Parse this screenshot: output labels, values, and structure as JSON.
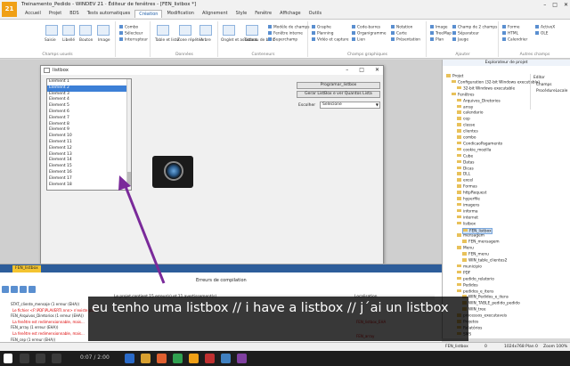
{
  "window": {
    "title": "Treinamento_Pedido - WINDEV 21 · Éditeur de fenêtres - [FEN_listbox *]",
    "logo": "21"
  },
  "ribbon_tabs": [
    {
      "label": "Accueil",
      "active": false
    },
    {
      "label": "Projet",
      "active": false
    },
    {
      "label": "BDS",
      "active": false
    },
    {
      "label": "Tests automatiques",
      "active": false
    },
    {
      "label": "Création",
      "active": true
    },
    {
      "label": "Modification",
      "active": false
    },
    {
      "label": "Alignement",
      "active": false
    },
    {
      "label": "Style",
      "active": false
    },
    {
      "label": "Fenêtre",
      "active": false
    },
    {
      "label": "Affichage",
      "active": false
    },
    {
      "label": "Outils",
      "active": false
    }
  ],
  "ribbon": {
    "groups": [
      "Champs usuels",
      "Données",
      "Conteneurs",
      "Champs graphiques",
      "Ajouter",
      "Autres champs"
    ],
    "buttons": [
      "Saisie",
      "Libellé",
      "Bouton",
      "Image",
      "Table et liste",
      "Zone répétée",
      "Arbre",
      "Onglet et assistant",
      "Tableau de bord"
    ],
    "small_items": [
      "Combo",
      "Sélecteur",
      "Interrupteur",
      "Modèle de champs",
      "Fenêtre interne",
      "Superchamp",
      "Graphe",
      "Planning",
      "Vidéo et capture",
      "Code-barres",
      "Organigramme",
      "Lien",
      "Notation",
      "Carte",
      "Présentation",
      "Image",
      "TreeMap",
      "Plan",
      "Champ de 2 champs",
      "Séparateur",
      "Jauge",
      "Forme",
      "HTML",
      "Calendrier",
      "ActiveX",
      "OLE"
    ]
  },
  "form": {
    "title": "listbox",
    "listbox_items": [
      "Element 1",
      "Element 2",
      "Element 3",
      "Element 4",
      "Element 5",
      "Element 6",
      "Element 7",
      "Element 8",
      "Element 9",
      "Element 10",
      "Element 11",
      "Element 12",
      "Element 13",
      "Element 14",
      "Element 15",
      "Element 16",
      "Element 17",
      "Element 18"
    ],
    "selected_item_index": 1,
    "btn_program": "Programar_listbox",
    "btn_generate": "Gerar ListBox e ver Quantos Lista",
    "combo_label": "Escolher",
    "combo_value": "Selecione"
  },
  "project_explorer": {
    "title": "Explorateur de projet",
    "side_title": "Editor",
    "side_items": [
      "Champs",
      "ProcédureLocale"
    ],
    "tree": [
      {
        "label": "Projet",
        "depth": 0
      },
      {
        "label": "Configuration (32-bit Windows executable)",
        "depth": 1
      },
      {
        "label": "32-bit Windows executable",
        "depth": 2
      },
      {
        "label": "Fenêtres",
        "depth": 1
      },
      {
        "label": "Arquivos_Diretorios",
        "depth": 2
      },
      {
        "label": "array",
        "depth": 2
      },
      {
        "label": "calendario",
        "depth": 2
      },
      {
        "label": "cep",
        "depth": 2
      },
      {
        "label": "classe",
        "depth": 2
      },
      {
        "label": "clientes",
        "depth": 2
      },
      {
        "label": "combo",
        "depth": 2
      },
      {
        "label": "CondicaoPagamento",
        "depth": 2
      },
      {
        "label": "cookie_mozilla",
        "depth": 2
      },
      {
        "label": "Cube",
        "depth": 2
      },
      {
        "label": "Datas",
        "depth": 2
      },
      {
        "label": "Dicas",
        "depth": 2
      },
      {
        "label": "DLL",
        "depth": 2
      },
      {
        "label": "excel",
        "depth": 2
      },
      {
        "label": "Formas",
        "depth": 2
      },
      {
        "label": "httpRequest",
        "depth": 2
      },
      {
        "label": "hyperfile",
        "depth": 2
      },
      {
        "label": "imagens",
        "depth": 2
      },
      {
        "label": "informa",
        "depth": 2
      },
      {
        "label": "internet",
        "depth": 2
      },
      {
        "label": "listbox",
        "depth": 2
      },
      {
        "label": "FEN_listbox",
        "depth": 3,
        "selected": true
      },
      {
        "label": "mensagem",
        "depth": 2
      },
      {
        "label": "FEN_mensagem",
        "depth": 3
      },
      {
        "label": "Menu",
        "depth": 2
      },
      {
        "label": "FEN_menu",
        "depth": 3
      },
      {
        "label": "WIN_table_clientes2",
        "depth": 3
      },
      {
        "label": "municipio",
        "depth": 2
      },
      {
        "label": "PDF",
        "depth": 2
      },
      {
        "label": "pedido_relatorio",
        "depth": 2
      },
      {
        "label": "Pedidos",
        "depth": 2
      },
      {
        "label": "pedidos_e_itens",
        "depth": 2
      },
      {
        "label": "WIN_Pedidos_e_itens",
        "depth": 3
      },
      {
        "label": "WIN_TABLE_pedido_pedido",
        "depth": 3
      },
      {
        "label": "WIN_tree",
        "depth": 3
      },
      {
        "label": "processos_executaveis",
        "depth": 2
      },
      {
        "label": "Projetos",
        "depth": 2
      },
      {
        "label": "Relatórios",
        "depth": 2
      },
      {
        "label": "SMS",
        "depth": 2
      }
    ]
  },
  "bottom_panel": {
    "tab": "FEN_listbox",
    "title": "Erreurs de compilation",
    "grid_header": "Le projet contient 15 erreur(s) et 11 avertissement(s)",
    "grid_right": "Localisation",
    "errors": [
      {
        "text": "STAT_cliente_mensaje (1 erreur (EHA))",
        "red": false
      },
      {
        "text": "Le fichier <F:\\PDF\\PLAVERTI.nnn> n'existe pas",
        "red": true
      },
      {
        "text": "FEN_Arquivos_Diretorios (1 erreur (EHA))",
        "red": false
      },
      {
        "text": "La fenêtre est redimensionnable, mais...",
        "red": true
      },
      {
        "text": "FEN_array (1 erreur (EHA))",
        "red": false
      },
      {
        "text": "La fenêtre est redimensionnable, mais...",
        "red": true
      },
      {
        "text": "FEN_cep (1 erreur (EHA))",
        "red": false
      }
    ],
    "right_errors": [
      "FEN_listbox_EHA",
      "FEN_array"
    ]
  },
  "caption": "eu tenho uma listbox // i have a listbox // j´ai un listbox",
  "statusbar": {
    "left": "FEN_listbox",
    "mid1": "0",
    "mid2": "1024x768",
    "mid3": "Plan 0",
    "zoom": "Zoom 100%"
  },
  "video": {
    "time": "0:07 / 2:00"
  },
  "colors": {
    "accent": "#f0a016",
    "selection": "#3c7fd6",
    "arrow": "#7a2a9a",
    "error": "#dd0000"
  }
}
